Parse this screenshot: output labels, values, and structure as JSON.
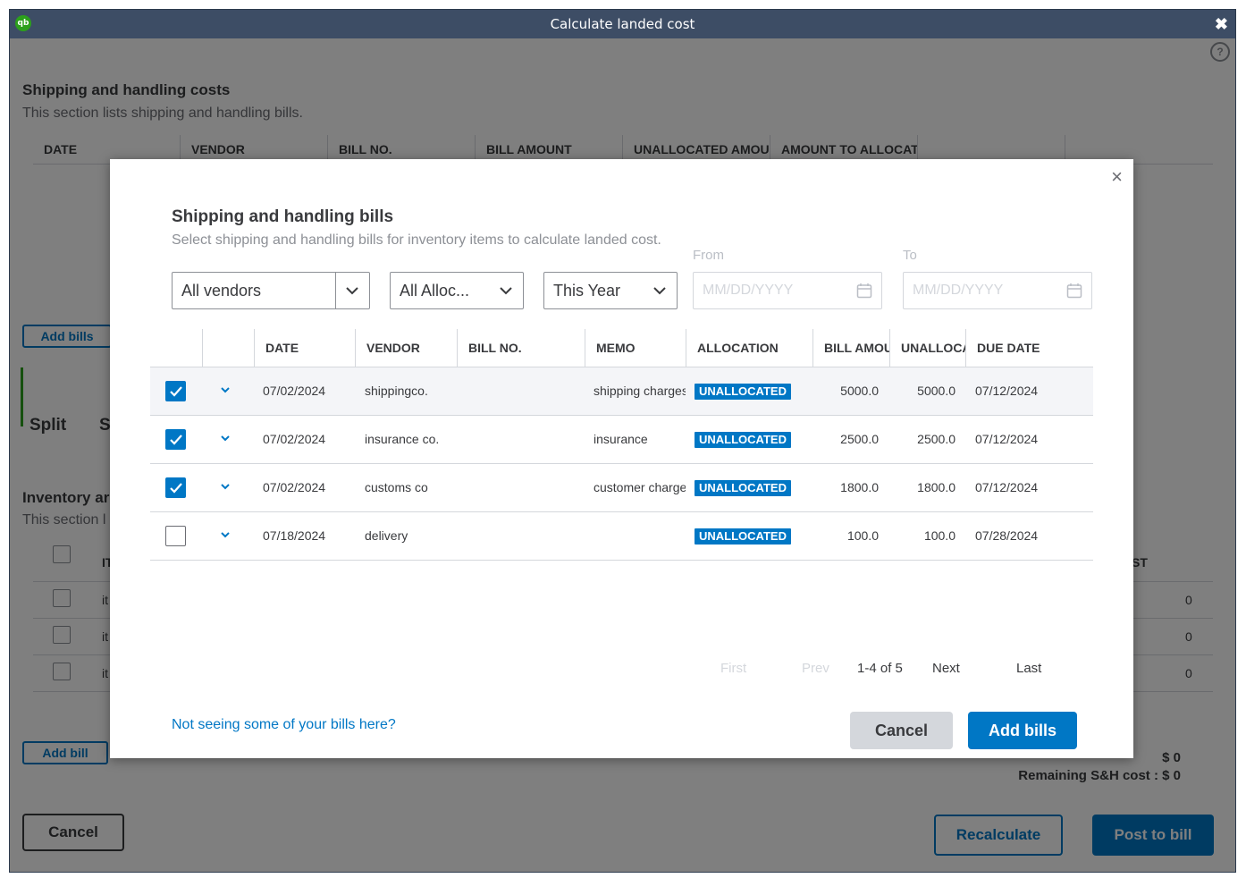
{
  "window": {
    "title": "Calculate landed cost"
  },
  "background": {
    "section1_title": "Shipping and handling costs",
    "section1_sub": "This section lists shipping and handling bills.",
    "section1_columns": [
      "DATE",
      "VENDOR",
      "BILL NO.",
      "BILL AMOUNT",
      "UNALLOCATED AMOUNT",
      "AMOUNT TO ALLOCATE"
    ],
    "add_bills_label": "Add bills",
    "split_label": "Split",
    "split_partial": "S",
    "section2_title": "Inventory ar",
    "section2_sub": "This section l",
    "section2_col_partial": "IT",
    "section2_col_right": "ST",
    "section2_rows": [
      {
        "item": "it",
        "value": "0"
      },
      {
        "item": "it",
        "value": "0"
      },
      {
        "item": "it",
        "value": "0"
      }
    ],
    "add_bill_label": "Add bill",
    "total_value": "$ 0",
    "remaining_label": "Remaining S&H cost : $ 0",
    "cancel_label": "Cancel",
    "recalculate_label": "Recalculate",
    "post_label": "Post to bill"
  },
  "modal": {
    "title": "Shipping and handling bills",
    "subtitle": "Select shipping and handling bills for inventory items to calculate landed cost.",
    "filters": {
      "vendor": "All vendors",
      "allocation": "All Alloc...",
      "period": "This Year",
      "from_label": "From",
      "to_label": "To",
      "from_placeholder": "MM/DD/YYYY",
      "to_placeholder": "MM/DD/YYYY"
    },
    "columns": [
      "DATE",
      "VENDOR",
      "BILL NO.",
      "MEMO",
      "ALLOCATION",
      "BILL AMOUNT",
      "UNALLOCATED",
      "DUE DATE"
    ],
    "rows": [
      {
        "checked": true,
        "date": "07/02/2024",
        "vendor": "shippingco.",
        "bill_no": "",
        "memo": "shipping charges",
        "allocation": "UNALLOCATED",
        "bill_amount": "5000.0",
        "unallocated": "5000.0",
        "due_date": "07/12/2024"
      },
      {
        "checked": true,
        "date": "07/02/2024",
        "vendor": "insurance co.",
        "bill_no": "",
        "memo": "insurance",
        "allocation": "UNALLOCATED",
        "bill_amount": "2500.0",
        "unallocated": "2500.0",
        "due_date": "07/12/2024"
      },
      {
        "checked": true,
        "date": "07/02/2024",
        "vendor": "customs co",
        "bill_no": "",
        "memo": "customer charges",
        "allocation": "UNALLOCATED",
        "bill_amount": "1800.0",
        "unallocated": "1800.0",
        "due_date": "07/12/2024"
      },
      {
        "checked": false,
        "date": "07/18/2024",
        "vendor": "delivery",
        "bill_no": "",
        "memo": "",
        "allocation": "UNALLOCATED",
        "bill_amount": "100.0",
        "unallocated": "100.0",
        "due_date": "07/28/2024"
      }
    ],
    "pager": {
      "first": "First",
      "prev": "Prev",
      "range": "1-4 of 5",
      "next": "Next",
      "last": "Last"
    },
    "link": "Not seeing some of your bills here?",
    "cancel_label": "Cancel",
    "add_label": "Add bills",
    "colors": {
      "primary": "#0077c5",
      "muted": "#d4d7dc",
      "titlebar": "#3d4d65"
    }
  }
}
